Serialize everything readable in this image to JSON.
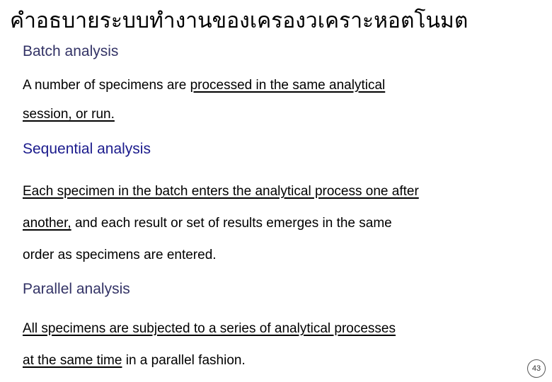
{
  "slide": {
    "title": "คำอธบายระบบทำงานของเครองวเคราะหอตโนมต",
    "page_number": "43",
    "colors": {
      "title": "#000000",
      "heading_navy": "#333366",
      "heading_blue": "#1a1a8c",
      "body": "#000000",
      "background": "#ffffff"
    },
    "sections": [
      {
        "heading": "Batch analysis",
        "lines": [
          {
            "plain_prefix": "A number of specimens are ",
            "underlined": "processed in the same analytical",
            "plain_suffix": ""
          },
          {
            "plain_prefix": "",
            "underlined": "session, or run.",
            "plain_suffix": ""
          }
        ]
      },
      {
        "heading": "Sequential analysis",
        "lines": [
          {
            "plain_prefix": "",
            "underlined": "Each specimen in the batch enters the analytical process one after",
            "plain_suffix": ""
          },
          {
            "plain_prefix": "",
            "underlined": "another,",
            "plain_suffix": " and each result or set of results emerges in the same"
          },
          {
            "plain_prefix": "order as specimens are entered.",
            "underlined": "",
            "plain_suffix": ""
          }
        ]
      },
      {
        "heading": "Parallel analysis",
        "lines": [
          {
            "plain_prefix": "",
            "underlined": "All specimens are subjected to a series of analytical processes",
            "plain_suffix": ""
          },
          {
            "plain_prefix": "",
            "underlined": "at the same time",
            "plain_suffix": " in a parallel fashion."
          }
        ]
      }
    ]
  }
}
